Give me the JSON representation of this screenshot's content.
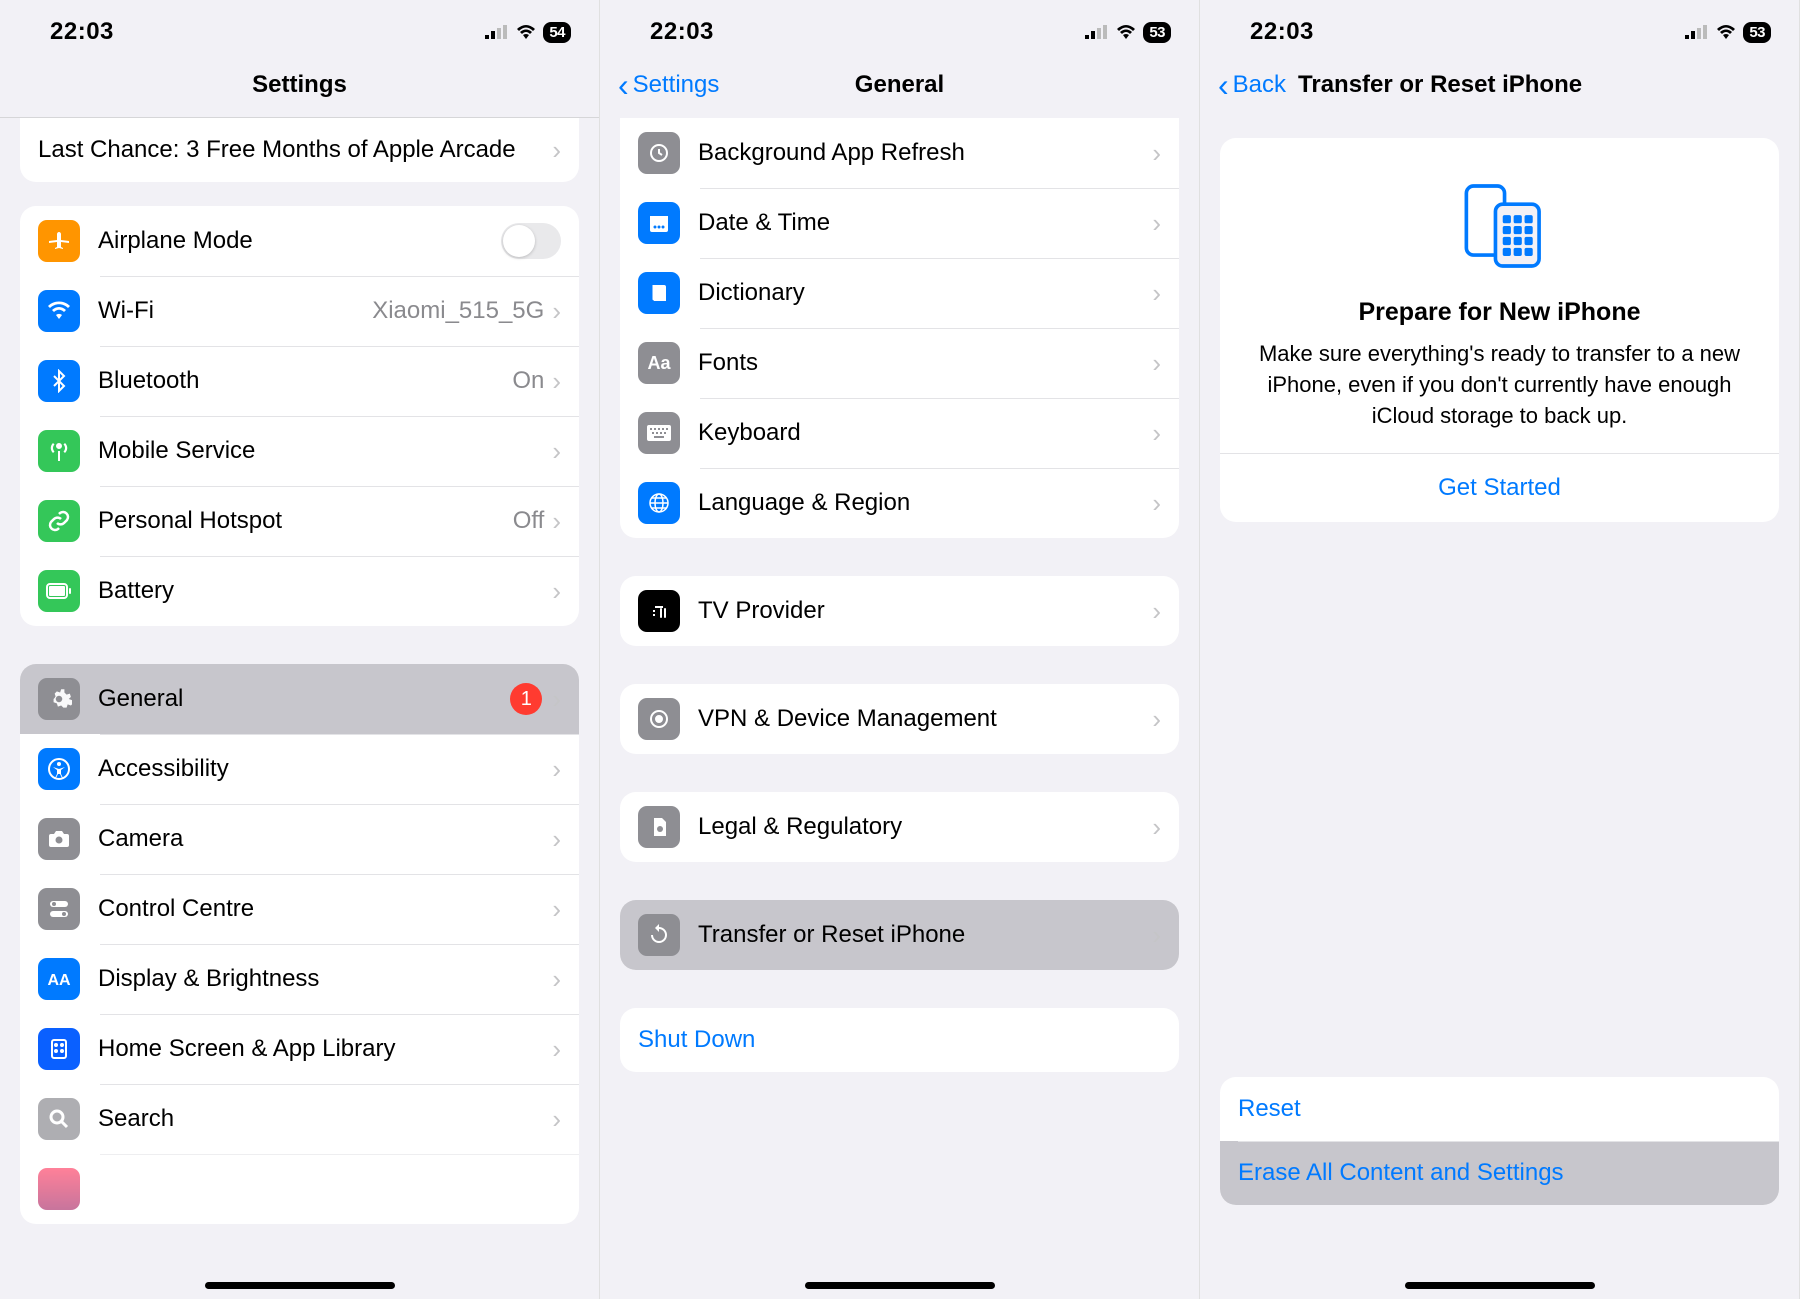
{
  "status": {
    "time": "22:03",
    "battery": "54",
    "battery2": "53"
  },
  "screen1": {
    "title": "Settings",
    "promo": "Last Chance: 3 Free Months of Apple Arcade",
    "connectivity": {
      "airplane": "Airplane Mode",
      "wifi": "Wi-Fi",
      "wifi_detail": "Xiaomi_515_5G",
      "bluetooth": "Bluetooth",
      "bluetooth_detail": "On",
      "mobile": "Mobile Service",
      "hotspot": "Personal Hotspot",
      "hotspot_detail": "Off",
      "battery": "Battery"
    },
    "main": {
      "general": "General",
      "general_badge": "1",
      "accessibility": "Accessibility",
      "camera": "Camera",
      "control": "Control Centre",
      "display": "Display & Brightness",
      "home": "Home Screen & App Library",
      "search": "Search"
    }
  },
  "screen2": {
    "back": "Settings",
    "title": "General",
    "rows": {
      "refresh": "Background App Refresh",
      "datetime": "Date & Time",
      "dictionary": "Dictionary",
      "fonts": "Fonts",
      "keyboard": "Keyboard",
      "language": "Language & Region",
      "tv": "TV Provider",
      "vpn": "VPN & Device Management",
      "legal": "Legal & Regulatory",
      "transfer": "Transfer or Reset iPhone",
      "shutdown": "Shut Down"
    }
  },
  "screen3": {
    "back": "Back",
    "title": "Transfer or Reset iPhone",
    "prepare": {
      "heading": "Prepare for New iPhone",
      "body": "Make sure everything's ready to transfer to a new iPhone, even if you don't currently have enough iCloud storage to back up.",
      "action": "Get Started"
    },
    "reset": "Reset",
    "erase": "Erase All Content and Settings"
  }
}
